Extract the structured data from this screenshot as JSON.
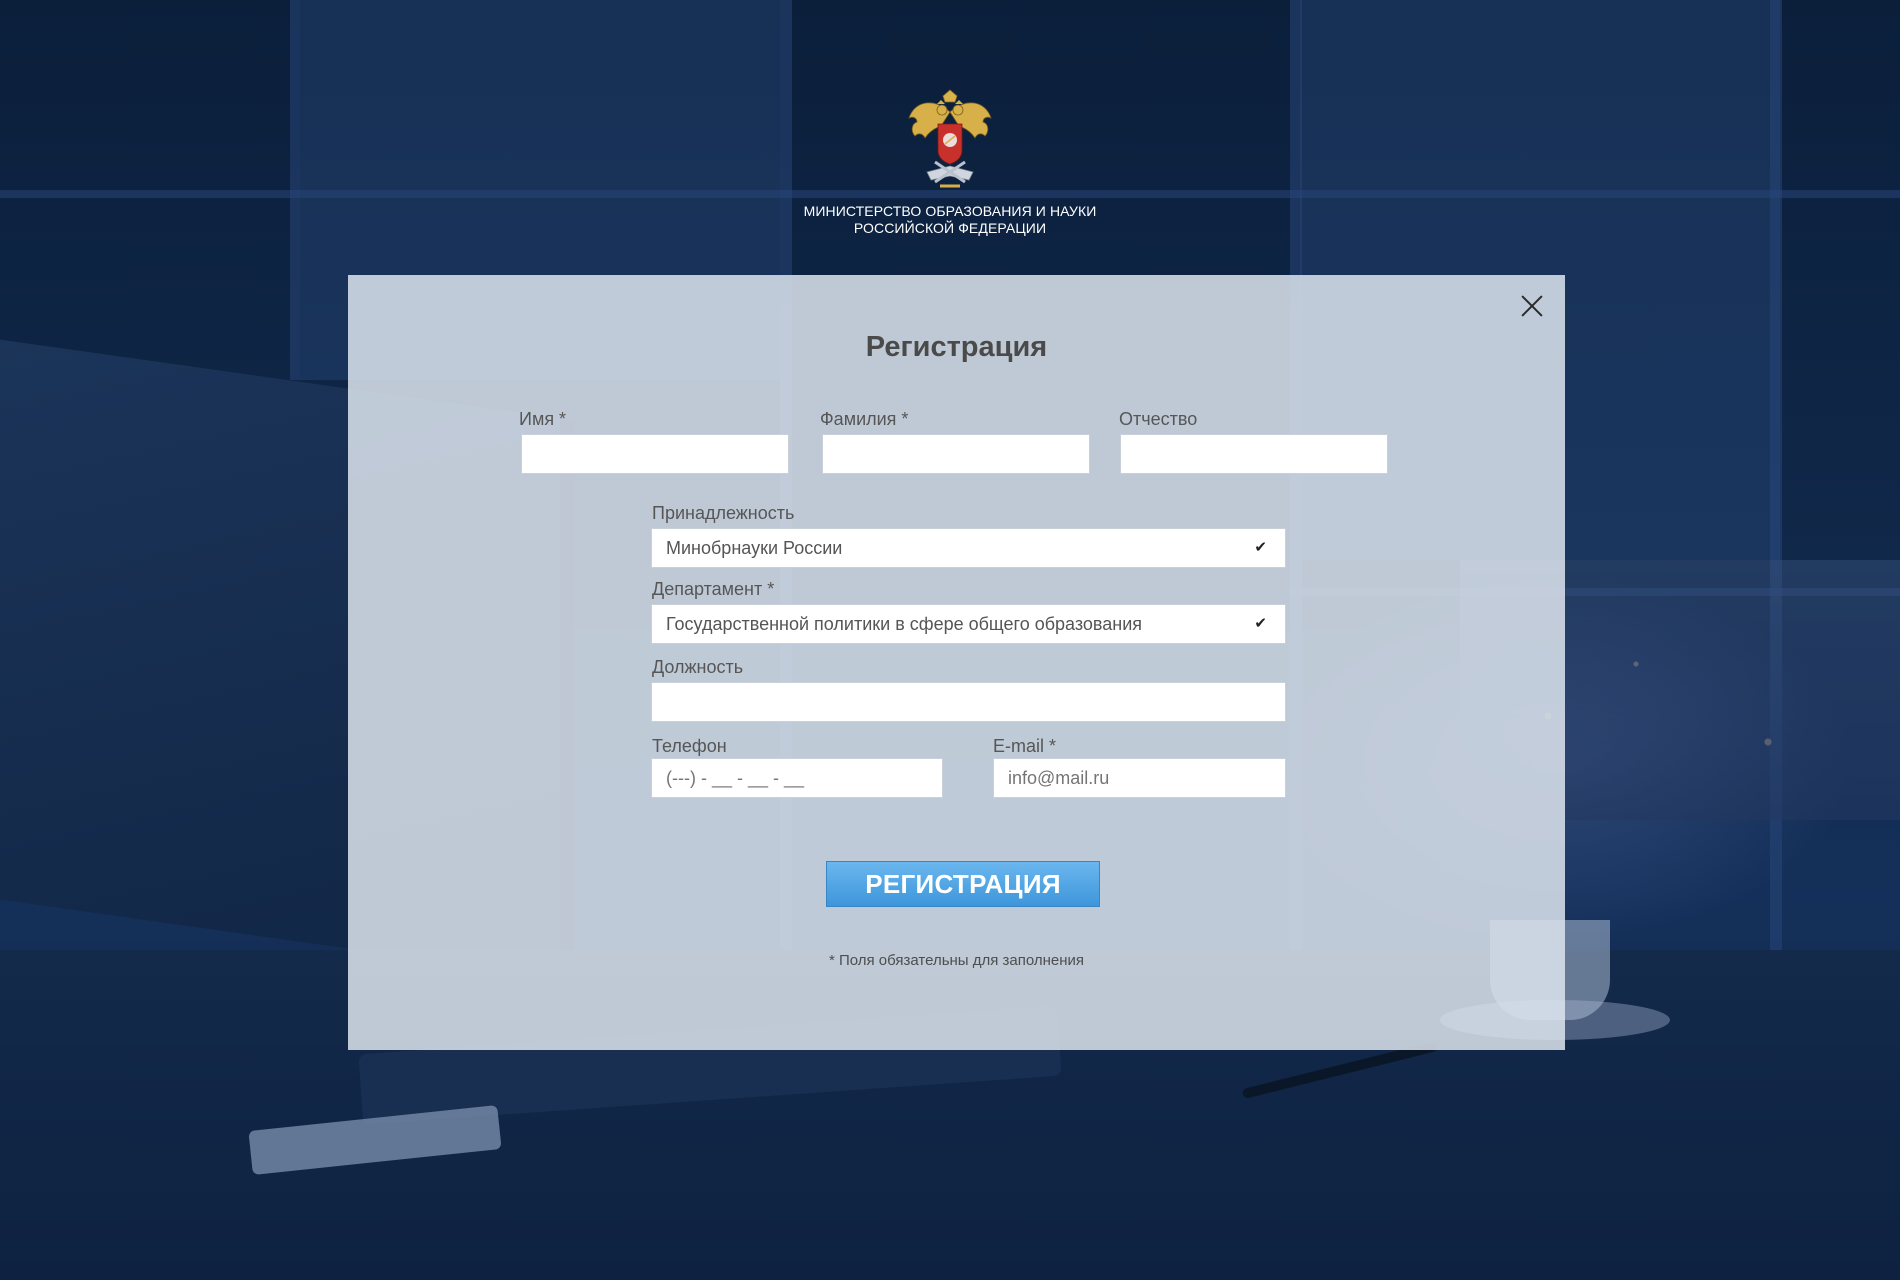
{
  "header": {
    "emblem_icon": "russian-coat-of-arms-emblem",
    "ministry_line1": "МИНИСТЕРСТВО ОБРАЗОВАНИЯ И НАУКИ",
    "ministry_line2": "РОССИЙСКОЙ ФЕДЕРАЦИИ"
  },
  "modal": {
    "title": "Регистрация",
    "close_icon": "close-icon"
  },
  "form": {
    "first_name": {
      "label": "Имя *",
      "value": ""
    },
    "last_name": {
      "label": "Фамилия *",
      "value": ""
    },
    "patronymic": {
      "label": "Отчество",
      "value": ""
    },
    "affiliation": {
      "label": "Принадлежность",
      "value": "Минобрнауки России",
      "icon": "check-icon"
    },
    "department": {
      "label": "Департамент *",
      "value": "Государственной политики в сфере общего образования",
      "icon": "check-icon"
    },
    "position": {
      "label": "Должность",
      "value": ""
    },
    "phone": {
      "label": "Телефон",
      "placeholder": "(---) - __ - __ - __"
    },
    "email": {
      "label": "E-mail *",
      "placeholder": "info@mail.ru"
    },
    "submit_label": "РЕГИСТРАЦИЯ",
    "required_note": "* Поля обязательны для заполнения"
  },
  "colors": {
    "accent_button": "#4aa3e4",
    "background": "#0f2647",
    "modal": "#dce4ee"
  }
}
